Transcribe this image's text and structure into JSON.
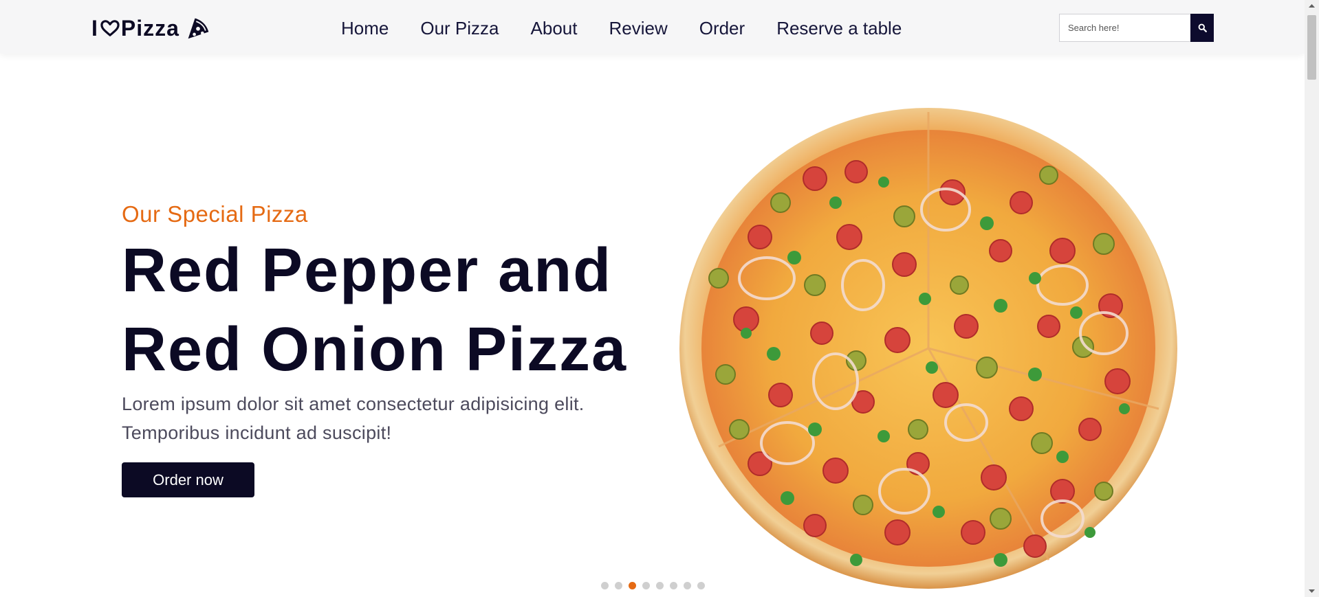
{
  "header": {
    "logo": {
      "prefix": "I",
      "suffix": "Pizza",
      "heart_icon": "heart-icon",
      "slice_icon": "pizza-slice-icon"
    },
    "nav": [
      {
        "label": "Home"
      },
      {
        "label": "Our Pizza"
      },
      {
        "label": "About"
      },
      {
        "label": "Review"
      },
      {
        "label": "Order"
      },
      {
        "label": "Reserve a table"
      }
    ],
    "search": {
      "placeholder": "Search here!",
      "value": "",
      "icon": "search-icon"
    }
  },
  "hero": {
    "subtitle": "Our Special Pizza",
    "title": "Red Pepper and Red Onion Pizza",
    "description": "Lorem ipsum dolor sit amet consectetur adipisicing elit. Temporibus incidunt ad suscipit!",
    "button_label": "Order now",
    "image": "pizza-image"
  },
  "carousel": {
    "total_slides": 8,
    "active_index": 2
  },
  "colors": {
    "accent": "#e56a13",
    "dark": "#0c0a24",
    "header_bg": "#f6f6f7",
    "text_muted": "#4c4a5c"
  }
}
